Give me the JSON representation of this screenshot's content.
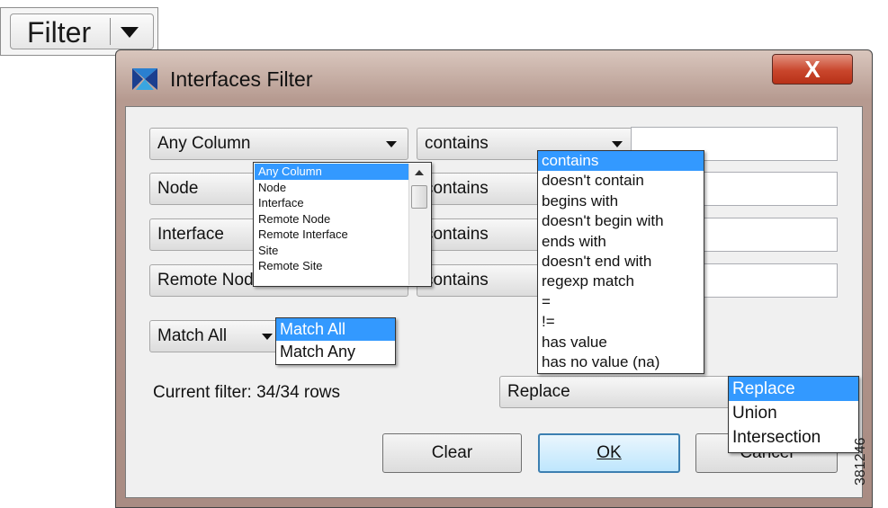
{
  "filter_button": {
    "label": "Filter"
  },
  "dialog": {
    "title": "Interfaces  Filter",
    "close_label": "X",
    "rows": [
      {
        "column": "Any Column",
        "operator": "contains",
        "value": ""
      },
      {
        "column": "Node",
        "operator": "contains",
        "value": ""
      },
      {
        "column": "Interface",
        "operator": "contains",
        "value": ""
      },
      {
        "column": "Remote Node",
        "operator": "contains",
        "value": ""
      }
    ],
    "match": {
      "selected": "Match All"
    },
    "status": "Current filter: 34/34 rows",
    "mode": {
      "selected": "Replace"
    },
    "buttons": {
      "clear": "Clear",
      "ok": "OK",
      "cancel": "Cancel"
    }
  },
  "column_dropdown": {
    "options": [
      "Any Column",
      "Node",
      "Interface",
      "Remote Node",
      "Remote Interface",
      "Site",
      "Remote Site"
    ],
    "selected_index": 0
  },
  "operator_dropdown": {
    "options": [
      "contains",
      "doesn't contain",
      "begins with",
      "doesn't begin with",
      "ends with",
      "doesn't end with",
      "regexp match",
      "=",
      "!=",
      "has value",
      "has no value (na)"
    ],
    "selected_index": 0
  },
  "match_dropdown": {
    "options": [
      "Match All",
      "Match Any"
    ],
    "selected_index": 0
  },
  "mode_dropdown": {
    "options": [
      "Replace",
      "Union",
      "Intersection"
    ],
    "selected_index": 0
  },
  "figure_number": "381246",
  "colors": {
    "selection": "#3399ff",
    "close_button": "#c9462c",
    "window_frame": "#b69a90"
  }
}
